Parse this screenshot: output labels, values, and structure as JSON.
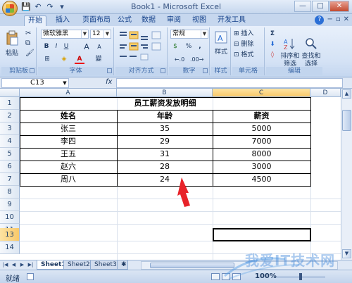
{
  "window": {
    "title": "Book1 - Microsoft Excel",
    "controls": [
      "—",
      "□",
      "✕"
    ]
  },
  "tabs": [
    "开始",
    "插入",
    "页面布局",
    "公式",
    "数据",
    "审阅",
    "视图",
    "开发工具"
  ],
  "ribbon": {
    "clipboard": {
      "label": "剪贴板",
      "paste": "粘贴"
    },
    "font": {
      "label": "字体",
      "family": "微软雅黑",
      "size": "12",
      "bold": "B",
      "italic": "I",
      "underline": "U",
      "grow": "A",
      "shrink": "A",
      "color_glyph": "A",
      "wen": "變"
    },
    "alignment": {
      "label": "对齐方式"
    },
    "number": {
      "label": "数字",
      "format": "常规",
      "percent": "%",
      "comma": ",",
      "currency": "$"
    },
    "styles": {
      "label": "样式",
      "styles_btn": "样式"
    },
    "cells": {
      "label": "单元格",
      "insert": "插入",
      "delete": "删除",
      "format": "格式"
    },
    "editing": {
      "label": "编辑",
      "sum": "Σ",
      "sort": "排序和\n筛选",
      "find": "查找和\n选择"
    }
  },
  "formula_bar": {
    "name_box": "C13",
    "fx": "fx",
    "formula": ""
  },
  "columns": [
    "A",
    "B",
    "C",
    "D"
  ],
  "rows": [
    "1",
    "2",
    "3",
    "4",
    "5",
    "6",
    "7",
    "8",
    "9",
    "10",
    "11",
    "12",
    "13",
    "14"
  ],
  "table": {
    "title": "员工薪资发放明细",
    "headers": [
      "姓名",
      "年龄",
      "薪资"
    ],
    "rows": [
      [
        "张三",
        "35",
        "5000"
      ],
      [
        "李四",
        "29",
        "7000"
      ],
      [
        "王五",
        "31",
        "8000"
      ],
      [
        "赵六",
        "28",
        "3000"
      ],
      [
        "周八",
        "24",
        "4500"
      ]
    ]
  },
  "sheets": [
    "Sheet1",
    "Sheet2",
    "Sheet3"
  ],
  "status": {
    "ready": "就绪",
    "zoom": "100%"
  },
  "watermark": "我爱IT技术网",
  "colors": {
    "accent": "#f8c86a",
    "annotation_arrow": "#e8232a",
    "ribbon": "#d4e2f5"
  }
}
